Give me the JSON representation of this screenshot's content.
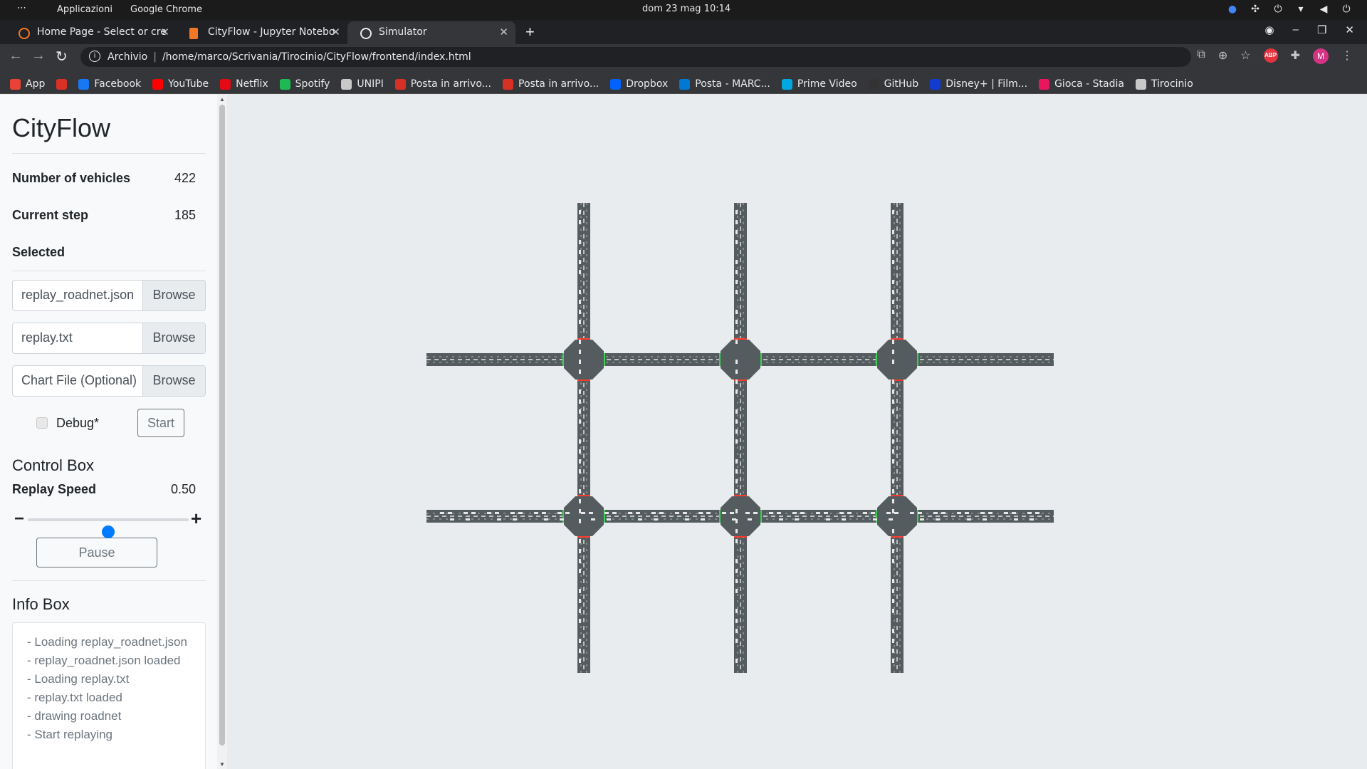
{
  "os": {
    "dots": "⋯",
    "applications": "Applicazioni",
    "app_name": "Google Chrome",
    "clock": "dom 23 mag  10:14"
  },
  "tabs": [
    {
      "title": "Home Page - Select or cre",
      "color": "#f37726"
    },
    {
      "title": "CityFlow - Jupyter Notebo",
      "color": "#f37726"
    },
    {
      "title": "Simulator",
      "color": "#e8eaed"
    }
  ],
  "address": {
    "label": "Archivio",
    "url": "/home/marco/Scrivania/Tirocinio/CityFlow/frontend/index.html"
  },
  "bookmarks": [
    {
      "label": "App",
      "icon": "apps-icon",
      "color": "#ea4335"
    },
    {
      "label": "",
      "icon": "gmail-icon",
      "color": "#d93025"
    },
    {
      "label": "Facebook",
      "icon": "facebook-icon",
      "color": "#1877f2"
    },
    {
      "label": "YouTube",
      "icon": "youtube-icon",
      "color": "#ff0000"
    },
    {
      "label": "Netflix",
      "icon": "netflix-icon",
      "color": "#e50914"
    },
    {
      "label": "Spotify",
      "icon": "spotify-icon",
      "color": "#1db954"
    },
    {
      "label": "UNIPI",
      "icon": "folder-icon",
      "color": "#c8c8c8"
    },
    {
      "label": "Posta in arrivo...",
      "icon": "gmail-icon",
      "color": "#d93025"
    },
    {
      "label": "Posta in arrivo...",
      "icon": "gmail-icon",
      "color": "#d93025"
    },
    {
      "label": "Dropbox",
      "icon": "dropbox-icon",
      "color": "#0061ff"
    },
    {
      "label": "Posta - MARC...",
      "icon": "outlook-icon",
      "color": "#0078d4"
    },
    {
      "label": "Prime Video",
      "icon": "prime-video-icon",
      "color": "#00a8e1"
    },
    {
      "label": "GitHub",
      "icon": "github-icon",
      "color": "#333333"
    },
    {
      "label": "Disney+ | Film...",
      "icon": "disney-icon",
      "color": "#113ccf"
    },
    {
      "label": "Gioca - Stadia",
      "icon": "stadia-icon",
      "color": "#e8175d"
    },
    {
      "label": "Tirocinio",
      "icon": "folder-icon",
      "color": "#c8c8c8"
    }
  ],
  "sidebar": {
    "title": "CityFlow",
    "vehicles_label": "Number of vehicles",
    "vehicles_value": "422",
    "step_label": "Current step",
    "step_value": "185",
    "selected_label": "Selected",
    "files": [
      {
        "name": "replay_roadnet.json",
        "browse": "Browse"
      },
      {
        "name": "replay.txt",
        "browse": "Browse"
      },
      {
        "name": "Chart File (Optional)",
        "browse": "Browse"
      }
    ],
    "debug_label": "Debug*",
    "start_label": "Start",
    "control_title": "Control Box",
    "speed_label": "Replay Speed",
    "speed_value": "0.50",
    "speed_fraction": 0.5,
    "minus": "−",
    "plus": "+",
    "pause_label": "Pause",
    "info_title": "Info Box",
    "info_lines": [
      "- Loading replay_roadnet.json",
      "- replay_roadnet.json loaded",
      "- Loading replay.txt",
      "- replay.txt loaded",
      "- drawing roadnet",
      "- Start replaying"
    ]
  },
  "roadnet": {
    "columns": 3,
    "rows": 2,
    "road_color": "#545c5f",
    "intersection_color": "#545c5f",
    "lane_mark_color": "#ffffff",
    "signal_green": "#39d353",
    "signal_red": "#ff3b30"
  }
}
